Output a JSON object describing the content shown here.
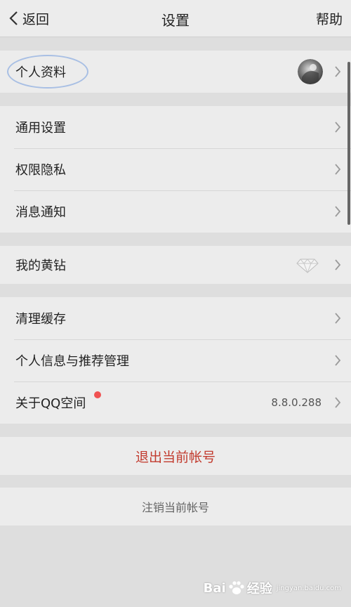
{
  "header": {
    "back_label": "返回",
    "title": "设置",
    "help_label": "帮助"
  },
  "profile": {
    "label": "个人资料"
  },
  "general": {
    "items": [
      {
        "label": "通用设置"
      },
      {
        "label": "权限隐私"
      },
      {
        "label": "消息通知"
      }
    ]
  },
  "yellow_diamond": {
    "label": "我的黄钻",
    "icon": "diamond-icon"
  },
  "misc": {
    "items": [
      {
        "label": "清理缓存"
      },
      {
        "label": "个人信息与推荐管理"
      },
      {
        "label": "关于QQ空间",
        "value": "8.8.0.288",
        "badge": "red-dot"
      }
    ]
  },
  "logout": {
    "label": "退出当前帐号",
    "color": "#c23b2e"
  },
  "deregister": {
    "label": "注销当前帐号"
  },
  "watermark": {
    "brand": "Bai",
    "brand_suffix": "经验",
    "sub": "jingyan.baidu.com"
  },
  "colors": {
    "background": "#dedede",
    "row_background": "#ececec",
    "logout_text": "#c23b2e",
    "badge": "#f05252",
    "highlight_oval": "#a8bfe4"
  }
}
